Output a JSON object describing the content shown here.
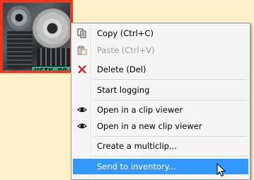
{
  "thumbnail": {
    "timecode": "VGIK 00;0"
  },
  "context_menu": {
    "items": [
      {
        "label": "Copy (Ctrl+C)",
        "icon": "copy-icon",
        "enabled": true
      },
      {
        "label": "Paste (Ctrl+V)",
        "icon": "paste-icon",
        "enabled": false
      },
      {
        "label": "Delete (Del)",
        "icon": "delete-icon",
        "enabled": true
      },
      {
        "label": "Start logging",
        "icon": "",
        "enabled": true
      },
      {
        "label": "Open in a clip viewer",
        "icon": "eye-icon",
        "enabled": true
      },
      {
        "label": "Open in a new clip viewer",
        "icon": "eye-icon",
        "enabled": true
      },
      {
        "label": "Create a multiclip...",
        "icon": "",
        "enabled": true
      },
      {
        "label": "Send to inventory...",
        "icon": "",
        "enabled": true,
        "highlighted": true
      }
    ]
  },
  "colors": {
    "background": "#fdf1c8",
    "thumbnail_border": "#e83a1f",
    "timecode_bg": "#3aa38f",
    "highlight": "#3399ff",
    "delete_red": "#cc1111"
  }
}
